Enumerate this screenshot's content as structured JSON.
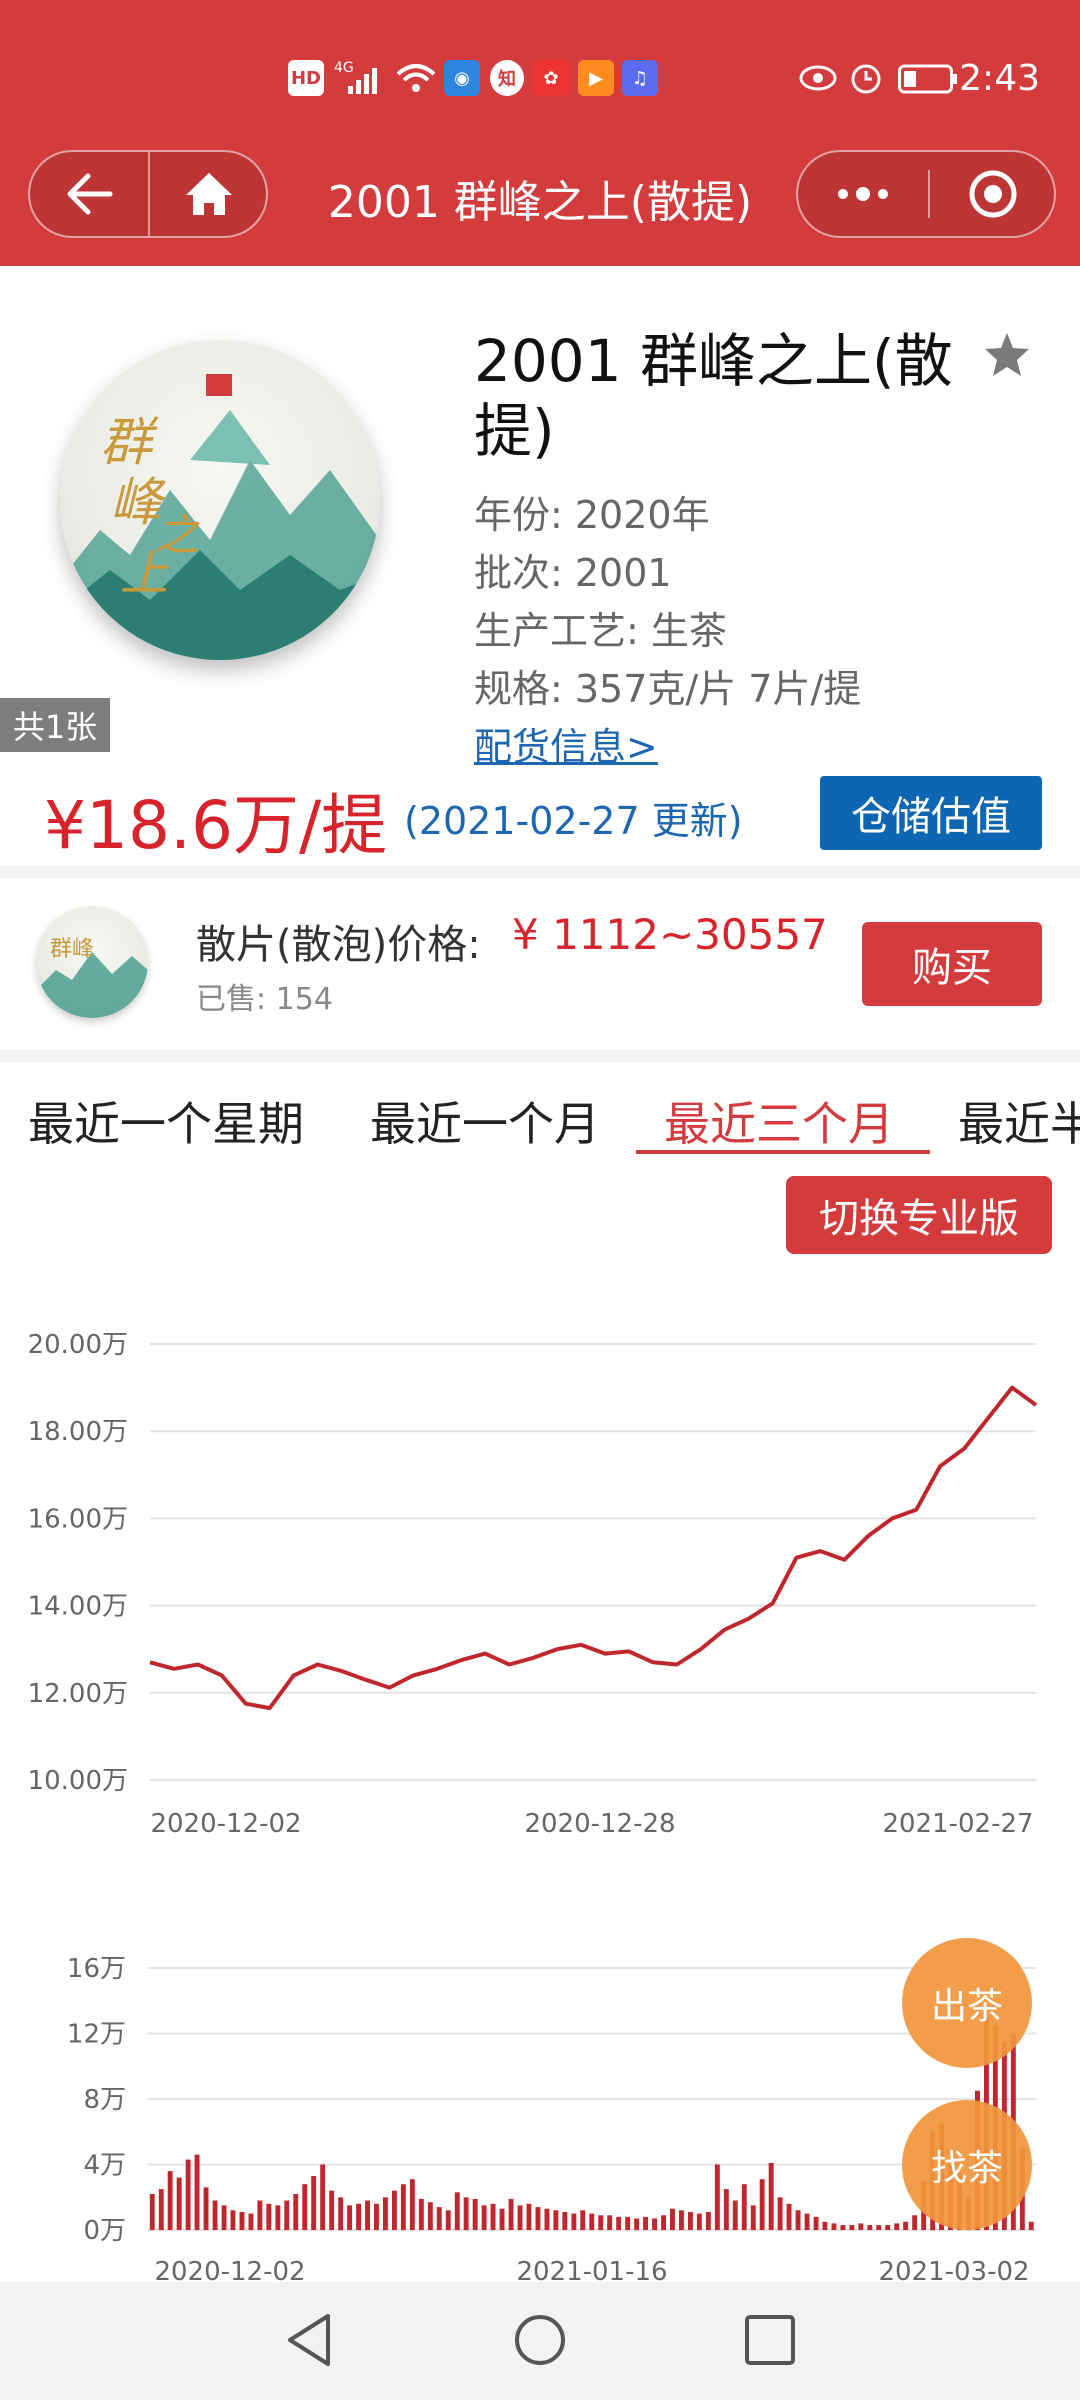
{
  "status_bar": {
    "left_icons": [
      "HD",
      "4G",
      "signal-icon",
      "wifi-icon",
      "app-icon",
      "知",
      "app-icon",
      "app-icon",
      "app-icon"
    ],
    "time": "2:43"
  },
  "navbar": {
    "title": "2001 群峰之上(散提)"
  },
  "product": {
    "title": "2001 群峰之上(散提)",
    "image_count": "共1张",
    "year": "年份: 2020年",
    "batch": "批次: 2001",
    "process": "生产工艺: 生茶",
    "spec": "规格: 357克/片 7片/提",
    "shipping_link": "配货信息>",
    "price": "¥18.6万/提",
    "price_date": "(2021-02-27 更新)",
    "storage_button": "仓储估值"
  },
  "loose": {
    "label": "散片(散泡)价格:",
    "price": "¥ 1112~30557",
    "sold": "已售: 154",
    "buy_button": "购买"
  },
  "tabs": [
    "最近一个星期",
    "最近一个月",
    "最近三个月",
    "最近半"
  ],
  "active_tab_index": 2,
  "pro_button": "切换专业版",
  "colors": {
    "brand_red": "#d43b3d",
    "price_red": "#d8232a",
    "link_blue": "#1d66b1",
    "button_blue": "#0d66b2",
    "chart_line": "#c0272d",
    "fab_orange": "#f0963c"
  },
  "chart_data": [
    {
      "type": "line",
      "x_ticks": [
        "2020-12-02",
        "2020-12-28",
        "2021-02-27"
      ],
      "y_ticks": [
        "20.00万",
        "18.00万",
        "16.00万",
        "14.00万",
        "12.00万",
        "10.00万"
      ],
      "ylim": [
        10,
        20
      ],
      "grid": true,
      "x_days": [
        0,
        2,
        4,
        6,
        8,
        10,
        12,
        14,
        16,
        18,
        20,
        22,
        24,
        26,
        28,
        30,
        32,
        34,
        36,
        38,
        40,
        42,
        44,
        46,
        48,
        50,
        52,
        54,
        56,
        58,
        60,
        62,
        64,
        66,
        68,
        70,
        72,
        74,
        76,
        78,
        80,
        82,
        84,
        86,
        88,
        89
      ],
      "values": [
        12.7,
        12.55,
        12.65,
        12.4,
        11.75,
        11.65,
        12.4,
        12.65,
        12.5,
        12.3,
        12.12,
        12.4,
        12.55,
        12.75,
        12.9,
        12.65,
        12.8,
        13.0,
        13.1,
        12.9,
        12.95,
        12.7,
        12.65,
        13.0,
        13.45,
        13.7,
        14.05,
        15.1,
        15.25,
        15.05,
        15.6,
        16.0,
        16.2,
        17.2,
        17.6,
        18.3,
        19.0,
        18.6,
        18.6,
        18.6,
        18.6,
        18.6,
        18.6,
        18.6,
        18.6,
        18.6
      ]
    },
    {
      "type": "bar",
      "x_ticks": [
        "2020-12-02",
        "2021-01-16",
        "2021-03-02"
      ],
      "y_ticks": [
        "16万",
        "12万",
        "8万",
        "4万",
        "0万"
      ],
      "ylim": [
        0,
        16
      ],
      "grid": true,
      "values": [
        2.2,
        2.5,
        3.6,
        3.2,
        4.3,
        4.6,
        2.6,
        1.8,
        1.5,
        1.2,
        1.1,
        1.0,
        1.8,
        1.6,
        1.5,
        1.8,
        2.2,
        2.8,
        3.3,
        4.0,
        2.4,
        2.0,
        1.5,
        1.6,
        1.8,
        1.6,
        2.0,
        2.4,
        2.8,
        3.1,
        1.9,
        1.7,
        1.4,
        1.2,
        2.3,
        2.0,
        1.9,
        1.5,
        1.6,
        1.3,
        1.9,
        1.5,
        1.6,
        1.4,
        1.3,
        1.2,
        1.1,
        1.0,
        1.2,
        1.0,
        0.9,
        0.9,
        0.8,
        0.8,
        0.7,
        0.8,
        0.7,
        0.9,
        1.3,
        1.2,
        1.1,
        1.0,
        1.1,
        4.0,
        2.5,
        1.8,
        2.8,
        1.5,
        3.1,
        4.1,
        2.0,
        1.6,
        1.2,
        1.0,
        0.8,
        0.5,
        0.4,
        0.3,
        0.3,
        0.4,
        0.3,
        0.3,
        0.3,
        0.4,
        0.5,
        0.9,
        3.0,
        6.0,
        6.5,
        4.0,
        3.5,
        2.0,
        8.5,
        13.0,
        12.5,
        11.5,
        12.0,
        5.0,
        0.5
      ]
    }
  ],
  "floating_buttons": [
    "出茶",
    "找茶"
  ]
}
